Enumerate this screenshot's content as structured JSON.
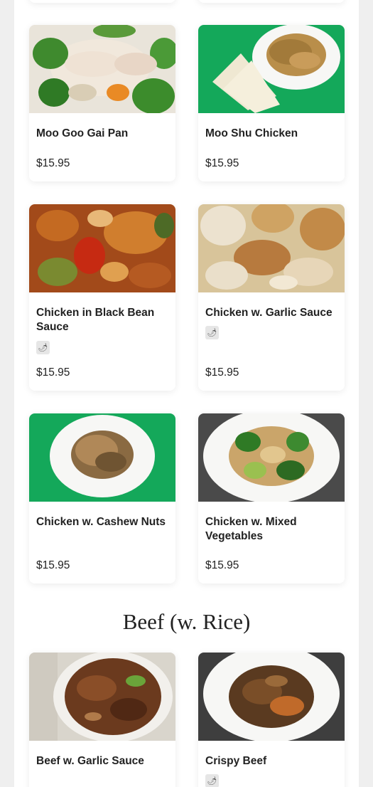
{
  "items": [
    {
      "name": "Moo Goo Gai Pan",
      "price": "$15.95"
    },
    {
      "name": "Moo Shu Chicken",
      "price": "$15.95"
    },
    {
      "name": "Chicken in Black Bean Sauce",
      "price": "$15.95",
      "tag": "🌶"
    },
    {
      "name": "Chicken w. Garlic Sauce",
      "price": "$15.95",
      "tag": "🌶"
    },
    {
      "name": "Chicken w. Cashew Nuts",
      "price": "$15.95"
    },
    {
      "name": "Chicken w. Mixed Vegetables",
      "price": "$15.95"
    }
  ],
  "section": {
    "title": "Beef (w. Rice)"
  },
  "beef_items": [
    {
      "name": "Beef w. Garlic Sauce"
    },
    {
      "name": "Crispy Beef",
      "tag": "🌶"
    }
  ],
  "colors": {
    "background": "#efefef",
    "card": "#ffffff",
    "text": "#222222",
    "green": "#14a85a"
  }
}
